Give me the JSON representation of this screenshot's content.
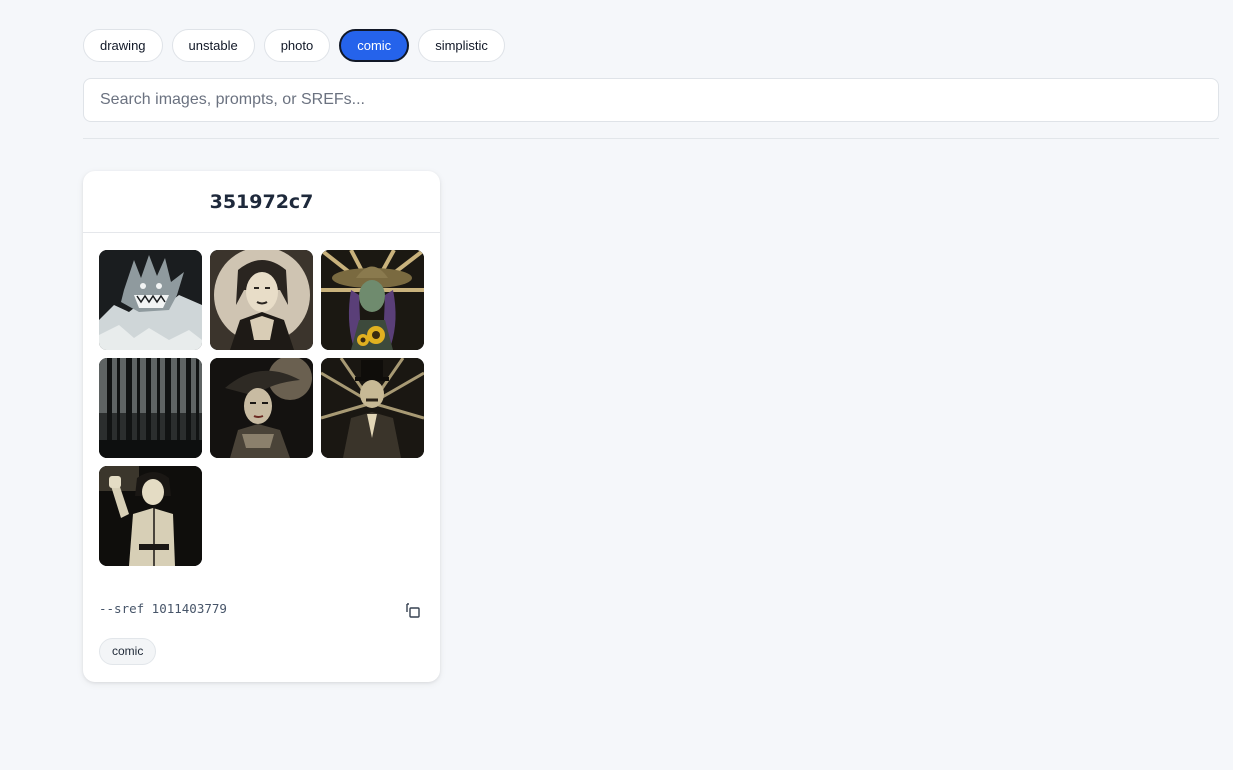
{
  "filters": [
    {
      "label": "drawing",
      "active": false
    },
    {
      "label": "unstable",
      "active": false
    },
    {
      "label": "photo",
      "active": false
    },
    {
      "label": "comic",
      "active": true
    },
    {
      "label": "simplistic",
      "active": false
    }
  ],
  "search": {
    "placeholder": "Search images, prompts, or SREFs...",
    "value": ""
  },
  "card": {
    "title": "351972c7",
    "images": [
      {
        "subject": "dragon"
      },
      {
        "subject": "woman-portrait"
      },
      {
        "subject": "woman-sunflower-hat"
      },
      {
        "subject": "dark-forest"
      },
      {
        "subject": "woman-feather-hat"
      },
      {
        "subject": "man-top-hat"
      },
      {
        "subject": "woman-waving"
      }
    ],
    "sref": "--sref 1011403779",
    "tags": [
      "comic"
    ]
  },
  "colors": {
    "accent": "#2563eb",
    "background": "#f5f7fa"
  }
}
